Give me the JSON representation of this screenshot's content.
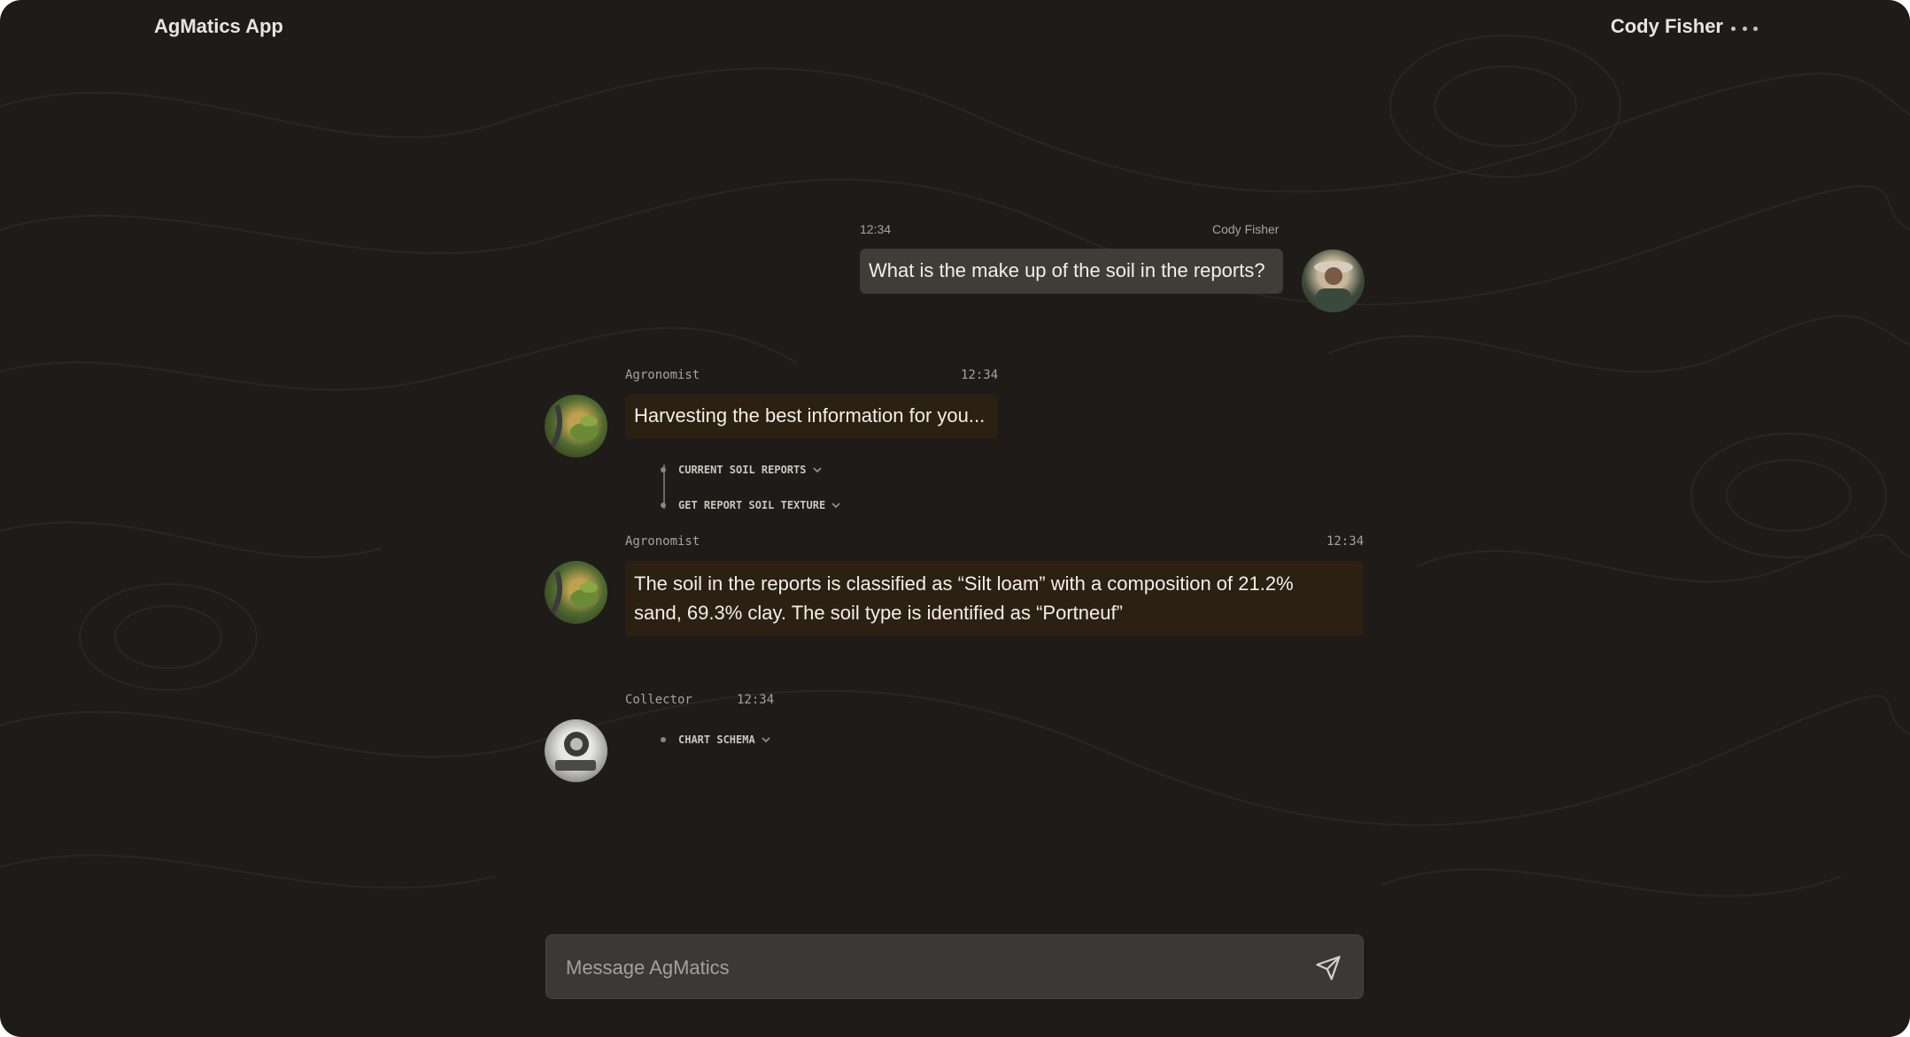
{
  "header": {
    "app_title": "AgMatics App",
    "user_name": "Cody Fisher",
    "more_icon": "more-horizontal-icon"
  },
  "messages": [
    {
      "sender": "Cody Fisher",
      "time": "12:34",
      "text": "What is the make up of the soil in the reports?",
      "role": "user"
    },
    {
      "sender": "Agronomist",
      "time": "12:34",
      "text": "Harvesting the best information for you...",
      "role": "agent",
      "tools": [
        "CURRENT SOIL REPORTS",
        "GET REPORT SOIL TEXTURE"
      ]
    },
    {
      "sender": "Agronomist",
      "time": "12:34",
      "line1": "The soil in the reports is classified as “Silt loam” with a composition of 21.2%",
      "line2": "sand, 69.3% clay. The soil type is identified as “Portneuf”",
      "role": "agent"
    },
    {
      "sender": "Collector",
      "time": "12:34",
      "role": "agent",
      "tools": [
        "CHART SCHEMA"
      ]
    }
  ],
  "composer": {
    "placeholder": "Message AgMatics",
    "send_icon": "send-icon"
  },
  "colors": {
    "background": "#1e1b19",
    "user_bubble": "#403c38",
    "agent_bubble": "#2c2013",
    "text": "#f2eee9"
  }
}
